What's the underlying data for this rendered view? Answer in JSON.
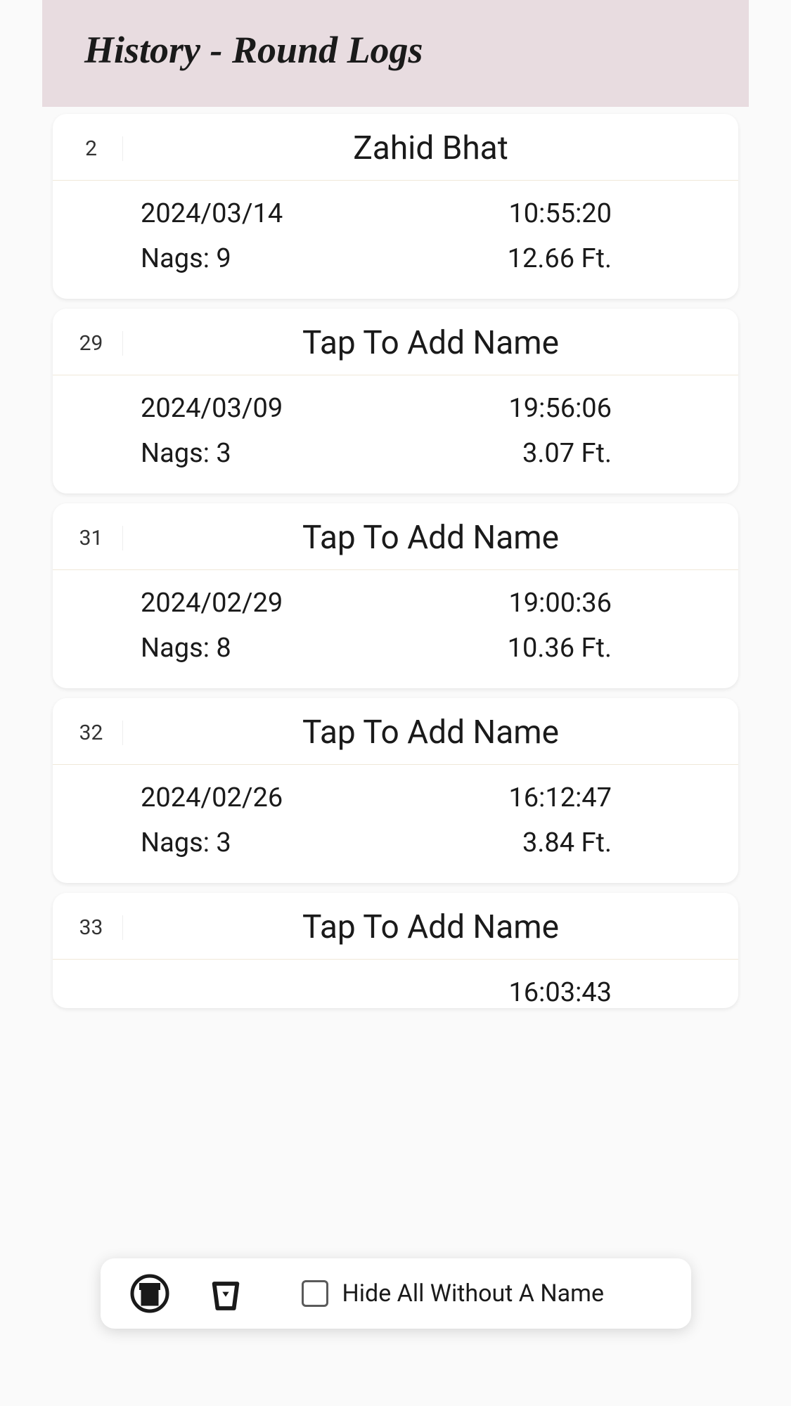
{
  "header": {
    "title": "History - Round Logs"
  },
  "entries": [
    {
      "number": "2",
      "name": "Zahid Bhat",
      "date": "2024/03/14",
      "time": "10:55:20",
      "nags": "Nags: 9",
      "feet": "12.66 Ft."
    },
    {
      "number": "29",
      "name": "Tap To Add Name",
      "date": "2024/03/09",
      "time": "19:56:06",
      "nags": "Nags: 3",
      "feet": "3.07 Ft."
    },
    {
      "number": "31",
      "name": "Tap To Add Name",
      "date": "2024/02/29",
      "time": "19:00:36",
      "nags": "Nags: 8",
      "feet": "10.36 Ft."
    },
    {
      "number": "32",
      "name": "Tap To Add Name",
      "date": "2024/02/26",
      "time": "16:12:47",
      "nags": "Nags: 3",
      "feet": "3.84 Ft."
    },
    {
      "number": "33",
      "name": "Tap To Add Name",
      "date": "",
      "time": "16:03:43",
      "nags": "",
      "feet": ""
    }
  ],
  "bottomBar": {
    "checkboxLabel": "Hide All Without A Name"
  }
}
